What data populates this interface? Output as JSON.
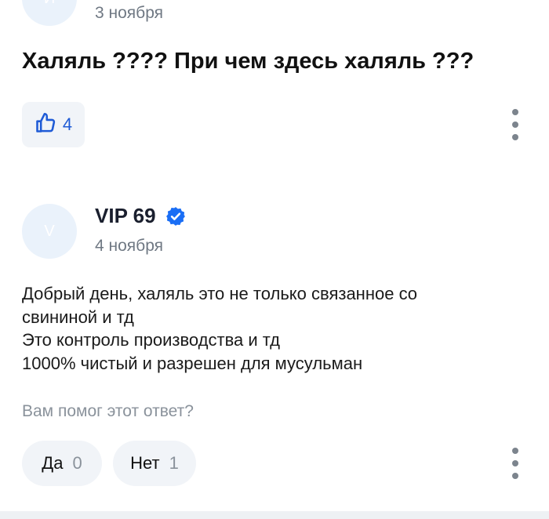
{
  "question_author": {
    "avatar_letter": "И",
    "date": "3 ноября"
  },
  "question": {
    "text": "Халяль ???? При чем здесь халяль ???",
    "likes": "4"
  },
  "answer": {
    "author_name": "VIP 69",
    "avatar_letter": "V",
    "verified": true,
    "date": "4 ноября",
    "lines": [
      "Добрый день, халяль это не только связанное со",
      "свининой и тд",
      "Это контроль производства и тд",
      "1000% чистый и разрешен для мусульман"
    ],
    "helpful_prompt": "Вам помог этот ответ?",
    "yes_label": "Да",
    "yes_count": "0",
    "no_label": "Нет",
    "no_count": "1"
  },
  "colors": {
    "accent": "#1f5bd6",
    "verified_badge": "#1a6ef5",
    "avatar_bg": "#eaf2fb",
    "pill_bg": "#f1f4f8"
  },
  "icons": {
    "like": "thumbs-up-icon",
    "menu": "kebab-menu-icon",
    "verified": "verified-check-icon"
  }
}
